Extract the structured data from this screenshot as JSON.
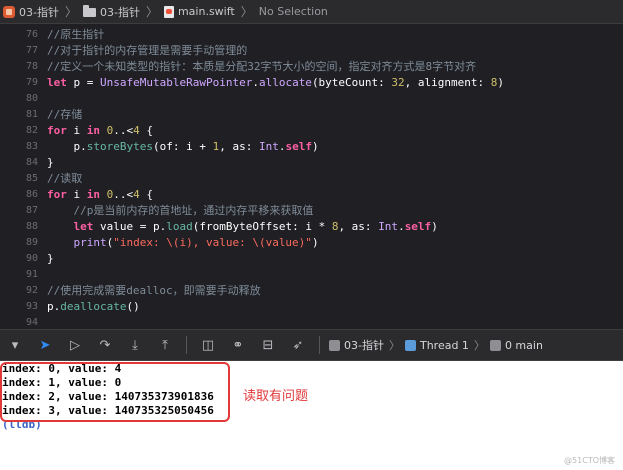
{
  "breadcrumb": {
    "project": "03-指针",
    "folder": "03-指针",
    "file": "main.swift",
    "selection": "No Selection"
  },
  "editor": {
    "lines": [
      {
        "n": "76",
        "tokens": [
          {
            "t": "//原生指针",
            "c": "comment"
          }
        ]
      },
      {
        "n": "77",
        "tokens": [
          {
            "t": "//对于指针的内存管理是需要手动管理的",
            "c": "comment"
          }
        ]
      },
      {
        "n": "78",
        "tokens": [
          {
            "t": "//定义一个未知类型的指针：本质是分配32字节大小的空间，指定对齐方式是8字节对齐",
            "c": "comment"
          }
        ]
      },
      {
        "n": "79",
        "tokens": [
          {
            "t": "let",
            "c": "kw"
          },
          {
            "t": " p = ",
            "c": "pln"
          },
          {
            "t": "UnsafeMutableRawPointer",
            "c": "type"
          },
          {
            "t": ".",
            "c": "pln"
          },
          {
            "t": "allocate",
            "c": "type"
          },
          {
            "t": "(byteCount: ",
            "c": "pln"
          },
          {
            "t": "32",
            "c": "num"
          },
          {
            "t": ", alignment: ",
            "c": "pln"
          },
          {
            "t": "8",
            "c": "num"
          },
          {
            "t": ")",
            "c": "pln"
          }
        ]
      },
      {
        "n": "80",
        "tokens": []
      },
      {
        "n": "81",
        "tokens": [
          {
            "t": "//存储",
            "c": "comment"
          }
        ]
      },
      {
        "n": "82",
        "tokens": [
          {
            "t": "for",
            "c": "kw"
          },
          {
            "t": " i ",
            "c": "pln"
          },
          {
            "t": "in",
            "c": "kw"
          },
          {
            "t": " ",
            "c": "pln"
          },
          {
            "t": "0",
            "c": "num"
          },
          {
            "t": "..<",
            "c": "pln"
          },
          {
            "t": "4",
            "c": "num"
          },
          {
            "t": " {",
            "c": "pln"
          }
        ]
      },
      {
        "n": "83",
        "tokens": [
          {
            "t": "    p.",
            "c": "pln"
          },
          {
            "t": "storeBytes",
            "c": "fn"
          },
          {
            "t": "(of: i + ",
            "c": "pln"
          },
          {
            "t": "1",
            "c": "num"
          },
          {
            "t": ", as: ",
            "c": "pln"
          },
          {
            "t": "Int",
            "c": "type"
          },
          {
            "t": ".",
            "c": "pln"
          },
          {
            "t": "self",
            "c": "kw"
          },
          {
            "t": ")",
            "c": "pln"
          }
        ]
      },
      {
        "n": "84",
        "tokens": [
          {
            "t": "}",
            "c": "pln"
          }
        ]
      },
      {
        "n": "85",
        "tokens": [
          {
            "t": "//读取",
            "c": "comment"
          }
        ]
      },
      {
        "n": "86",
        "tokens": [
          {
            "t": "for",
            "c": "kw"
          },
          {
            "t": " i ",
            "c": "pln"
          },
          {
            "t": "in",
            "c": "kw"
          },
          {
            "t": " ",
            "c": "pln"
          },
          {
            "t": "0",
            "c": "num"
          },
          {
            "t": "..<",
            "c": "pln"
          },
          {
            "t": "4",
            "c": "num"
          },
          {
            "t": " {",
            "c": "pln"
          }
        ]
      },
      {
        "n": "87",
        "tokens": [
          {
            "t": "    //p是当前内存的首地址，通过内存平移来获取值",
            "c": "comment"
          }
        ]
      },
      {
        "n": "88",
        "tokens": [
          {
            "t": "    ",
            "c": "pln"
          },
          {
            "t": "let",
            "c": "kw"
          },
          {
            "t": " value = p.",
            "c": "pln"
          },
          {
            "t": "load",
            "c": "fn"
          },
          {
            "t": "(fromByteOffset: i * ",
            "c": "pln"
          },
          {
            "t": "8",
            "c": "num"
          },
          {
            "t": ", as: ",
            "c": "pln"
          },
          {
            "t": "Int",
            "c": "type"
          },
          {
            "t": ".",
            "c": "pln"
          },
          {
            "t": "self",
            "c": "kw"
          },
          {
            "t": ")",
            "c": "pln"
          }
        ]
      },
      {
        "n": "89",
        "tokens": [
          {
            "t": "    ",
            "c": "pln"
          },
          {
            "t": "print",
            "c": "type"
          },
          {
            "t": "(",
            "c": "pln"
          },
          {
            "t": "\"index: \\(i), value: \\(value)\"",
            "c": "str"
          },
          {
            "t": ")",
            "c": "pln"
          }
        ]
      },
      {
        "n": "90",
        "tokens": [
          {
            "t": "}",
            "c": "pln"
          }
        ]
      },
      {
        "n": "91",
        "tokens": []
      },
      {
        "n": "92",
        "tokens": [
          {
            "t": "//使用完成需要dealloc，即需要手动释放",
            "c": "comment"
          }
        ]
      },
      {
        "n": "93",
        "tokens": [
          {
            "t": "p.",
            "c": "pln"
          },
          {
            "t": "deallocate",
            "c": "fn"
          },
          {
            "t": "()",
            "c": "pln"
          }
        ]
      },
      {
        "n": "94",
        "tokens": []
      }
    ]
  },
  "debugbar": {
    "target": "03-指针",
    "thread": "Thread 1",
    "frame": "0 main"
  },
  "console": {
    "lines": [
      "index: 0, value: 4",
      "index: 1, value: 0",
      "index: 2, value: 140735373901836",
      "index: 3, value: 140735325050456"
    ],
    "prompt": "(lldb)",
    "annotation": "读取有问题",
    "watermark": "@51CTO博客"
  }
}
